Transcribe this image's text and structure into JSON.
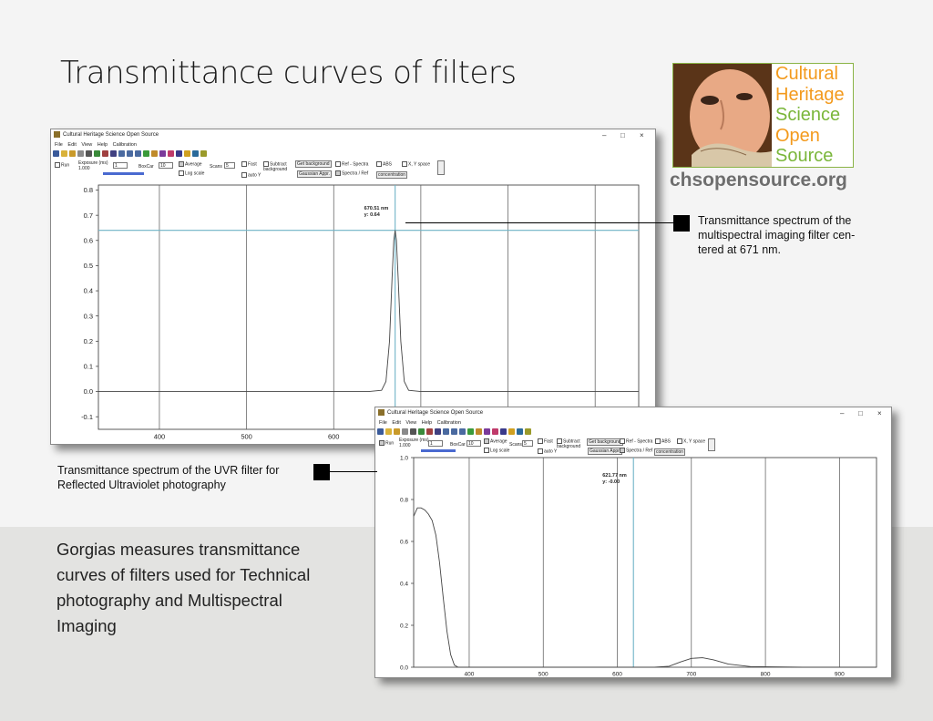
{
  "page_title": "Transmittance curves of filters",
  "logo": {
    "lines": [
      {
        "text": "Cultural",
        "color": "#f39a1d"
      },
      {
        "text": "Heritage",
        "color": "#f39a1d"
      },
      {
        "text": "Science",
        "color": "#7ab63a"
      },
      {
        "text": "Open",
        "color": "#f39a1d"
      },
      {
        "text": "Source",
        "color": "#7ab63a"
      }
    ],
    "url": "chsopensource.org"
  },
  "annotation_top": "Transmittance spectrum of the multispectral imaging filter centered at 671 nm.",
  "annotation_top_lines": [
    "Transmittance spectrum of the",
    "multispectral imaging filter cen-",
    "tered at 671 nm."
  ],
  "annotation_bottom_lines": [
    "Transmittance spectrum of the UVR filter for",
    "Reflected Ultraviolet photography"
  ],
  "body_text": "Gorgias measures transmittance curves of filters used for Technical photography and Multispectral Imaging",
  "body_text_lines": [
    "Gorgias measures transmittance",
    "curves of filters used for Technical",
    "photography and Multispectral",
    "Imaging"
  ],
  "app_window": {
    "title": "Cultural Heritage Science Open Source",
    "menu": [
      "File",
      "Edit",
      "View",
      "Help",
      "Calibration"
    ],
    "controls": {
      "run": "Run",
      "exposure_label": "Exposure (ms)",
      "exposure_value": "1.000",
      "exposure_field": "1",
      "boxcar_label": "BoxCar",
      "boxcar_value": "10",
      "average": "Average",
      "log_scale": "Log scale",
      "scans_label": "Scans",
      "scans_value": "5",
      "fast": "Fast",
      "auto_y": "auto Y",
      "subtract_background": "Subtract background",
      "get_background": "Get background",
      "gaussian_appr": "Gaussian Appr.",
      "ref_spectra": "Ref - Spectra",
      "spectra_ref": "Spectra / Ref",
      "abs": "ABS",
      "concentration": "concentration",
      "xy_space": "X, Y space"
    }
  },
  "chart_data": [
    {
      "type": "line",
      "title": "",
      "xlabel": "",
      "ylabel": "",
      "xlim": [
        330,
        950
      ],
      "ylim": [
        -0.15,
        0.82
      ],
      "x_ticks": [
        400,
        500,
        600,
        700,
        800,
        900
      ],
      "x_tick_labels": [
        "400",
        "500",
        "600"
      ],
      "y_ticks": [
        -0.1,
        0.0,
        0.1,
        0.2,
        0.3,
        0.4,
        0.5,
        0.6,
        0.7,
        0.8
      ],
      "y_tick_labels": [
        "-0.1",
        "0.0",
        "0.1",
        "0.2",
        "0.3",
        "0.4",
        "0.5",
        "0.6",
        "0.7",
        "0.8"
      ],
      "grid": true,
      "cursor": {
        "x": 670.51,
        "y": 0.64,
        "label_line1": "670.51 nm",
        "label_line2": "y: 0.64",
        "color": "#6fb3c6"
      },
      "series": [
        {
          "x": [
            330,
            400,
            500,
            600,
            640,
            655,
            660,
            664,
            667,
            669,
            670.5,
            672,
            674,
            677,
            681,
            686,
            700,
            800,
            950
          ],
          "y": [
            0.0,
            0.0,
            0.0,
            0.0,
            0.0,
            0.005,
            0.04,
            0.2,
            0.45,
            0.6,
            0.64,
            0.6,
            0.45,
            0.2,
            0.04,
            0.005,
            0.0,
            0.0,
            0.0
          ]
        }
      ]
    },
    {
      "type": "line",
      "title": "",
      "xlabel": "",
      "ylabel": "",
      "xlim": [
        325,
        950
      ],
      "ylim": [
        0.0,
        1.0
      ],
      "x_ticks": [
        400,
        500,
        600,
        700,
        800,
        900
      ],
      "x_tick_labels": [
        "400",
        "500",
        "600",
        "700",
        "800",
        "900"
      ],
      "y_ticks": [
        0.0,
        0.2,
        0.4,
        0.6,
        0.8,
        1.0
      ],
      "y_tick_labels": [
        "0.0",
        "0.2",
        "0.4",
        "0.6",
        "0.8",
        "1.0"
      ],
      "grid": true,
      "cursor": {
        "x": 621.77,
        "y": -0.0,
        "label_line1": "621.77 nm",
        "label_line2": "y: -0.00",
        "color": "#6fb3c6"
      },
      "series": [
        {
          "x": [
            325,
            330,
            335,
            340,
            345,
            350,
            355,
            360,
            365,
            370,
            375,
            380,
            385,
            390,
            400,
            500,
            600,
            650,
            670,
            685,
            700,
            715,
            730,
            750,
            780,
            850,
            950
          ],
          "y": [
            0.72,
            0.76,
            0.76,
            0.75,
            0.73,
            0.7,
            0.63,
            0.5,
            0.33,
            0.17,
            0.06,
            0.01,
            0.0,
            0.0,
            0.0,
            0.0,
            0.0,
            0.0,
            0.005,
            0.025,
            0.042,
            0.045,
            0.035,
            0.015,
            0.003,
            0.0,
            0.0
          ]
        }
      ]
    }
  ]
}
